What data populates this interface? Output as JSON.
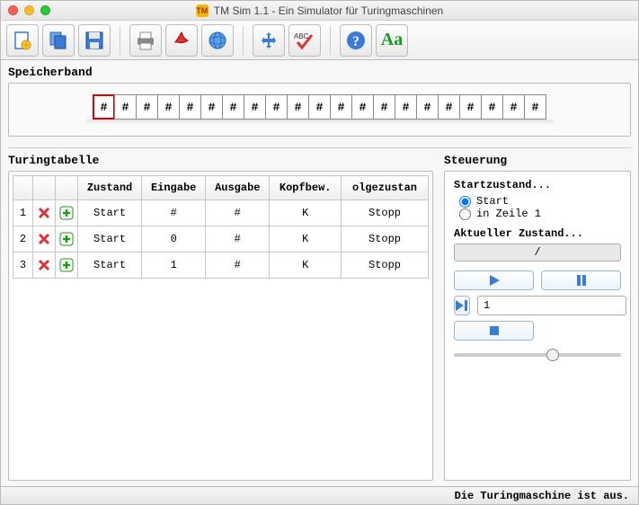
{
  "window": {
    "title": "TM Sim 1.1 - Ein Simulator für Turingmaschinen",
    "title_icon": "TM"
  },
  "toolbar": {
    "icons": [
      "new",
      "copy",
      "save",
      "print",
      "pdf",
      "web",
      "move",
      "check",
      "help",
      "font"
    ]
  },
  "tape": {
    "label": "Speicherband",
    "cells": [
      "#",
      "#",
      "#",
      "#",
      "#",
      "#",
      "#",
      "#",
      "#",
      "#",
      "#",
      "#",
      "#",
      "#",
      "#",
      "#",
      "#",
      "#",
      "#",
      "#",
      "#"
    ],
    "head_index": 0
  },
  "table": {
    "label": "Turingtabelle",
    "headers": [
      "",
      "",
      "",
      "Zustand",
      "Eingabe",
      "Ausgabe",
      "Kopfbew.",
      "olgezustan"
    ],
    "rows": [
      {
        "n": "1",
        "zustand": "Start",
        "eingabe": "#",
        "ausgabe": "#",
        "kopf": "K",
        "folge": "Stopp"
      },
      {
        "n": "2",
        "zustand": "Start",
        "eingabe": "0",
        "ausgabe": "#",
        "kopf": "K",
        "folge": "Stopp"
      },
      {
        "n": "3",
        "zustand": "Start",
        "eingabe": "1",
        "ausgabe": "#",
        "kopf": "K",
        "folge": "Stopp"
      }
    ]
  },
  "control": {
    "label": "Steuerung",
    "start_label": "Startzustand...",
    "radio_start": "Start",
    "radio_line": "in Zeile 1",
    "current_label": "Aktueller Zustand...",
    "current_value": "/",
    "step_value": "1",
    "slider_value": 60
  },
  "status": "Die Turingmaschine ist aus."
}
